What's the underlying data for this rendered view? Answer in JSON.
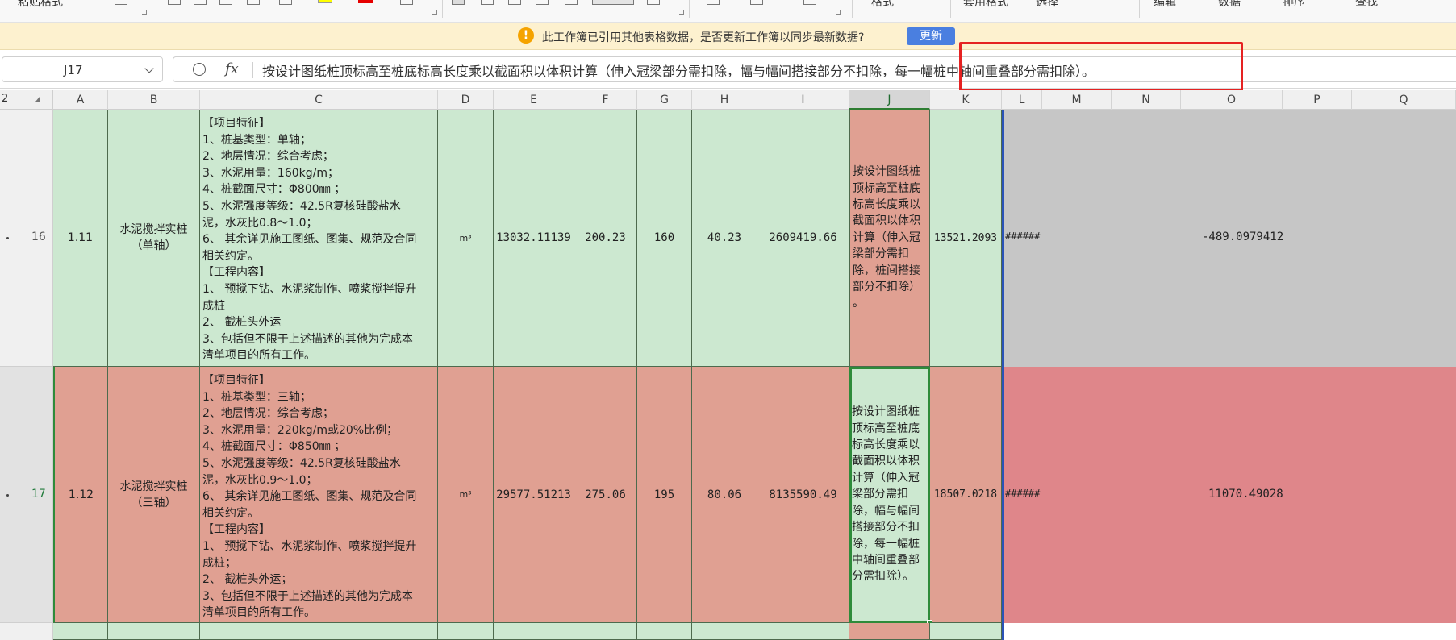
{
  "ribbon": {
    "items": [
      "粘贴格式",
      "格式",
      "编辑",
      "数据",
      "套用格式",
      "选择",
      "排序",
      "查找"
    ],
    "accent_colors": [
      "#ffff00",
      "#e60000"
    ]
  },
  "notification": {
    "icon": "warning-icon",
    "message": "此工作簿已引用其他表格数据，是否更新工作簿以同步最新数据?",
    "button": "更新"
  },
  "formula_bar": {
    "name_box": "J17",
    "fx": "fx",
    "content": "按设计图纸桩顶标高至桩底标高长度乘以截面积以体积计算（伸入冠梁部分需扣除，幅与幅间搭接部分不扣除，每一幅桩中轴间重叠部分需扣除）。"
  },
  "sheet": {
    "corner_label": "2",
    "columns": [
      "A",
      "B",
      "C",
      "D",
      "E",
      "F",
      "G",
      "H",
      "I",
      "J",
      "K",
      "L",
      "M",
      "N",
      "O",
      "P",
      "Q"
    ],
    "selected_column": "J",
    "rows": [
      {
        "row_number": "16",
        "A": "1.11",
        "B": "水泥搅拌实桩\n（单轴）",
        "C": "【项目特征】\n1、桩基类型：单轴；\n2、地层情况：综合考虑；\n3、水泥用量：160kg/m；\n4、桩截面尺寸：Φ800㎜ ；\n5、水泥强度等级：42.5R复核硅酸盐水\n泥，水灰比0.8～1.0；\n6、 其余详见施工图纸、图集、规范及合同\n相关约定。\n【工程内容】\n1、 预搅下钻、水泥浆制作、喷浆搅拌提升\n成桩\n2、 截桩头外运\n3、包括但不限于上述描述的其他为完成本\n清单项目的所有工作。",
        "D": "m³",
        "E": "13032.11139",
        "F": "200.23",
        "G": "160",
        "H": "40.23",
        "I": "2609419.66",
        "J": "按设计图纸桩\n顶标高至桩底\n标高长度乘以\n截面积以体积\n计算（伸入冠\n梁部分需扣\n除，桩间搭接\n部分不扣除）\n。",
        "K": "13521.2093",
        "L": "######",
        "O": "-489.0979412"
      },
      {
        "row_number": "17",
        "A": "1.12",
        "B": "水泥搅拌实桩\n（三轴）",
        "C": "【项目特征】\n1、桩基类型：三轴；\n2、地层情况：综合考虑；\n3、水泥用量：220kg/m或20%比例；\n4、桩截面尺寸：Φ850㎜ ；\n5、水泥强度等级：42.5R复核硅酸盐水\n泥，水灰比0.9～1.0；\n6、 其余详见施工图纸、图集、规范及合同\n相关约定。\n【工程内容】\n1、 预搅下钻、水泥浆制作、喷浆搅拌提升\n成桩；\n2、 截桩头外运；\n3、包括但不限于上述描述的其他为完成本\n清单项目的所有工作。",
        "D": "m³",
        "E": "29577.51213",
        "F": "275.06",
        "G": "195",
        "H": "80.06",
        "I": "8135590.49",
        "J": "按设计图纸桩\n顶标高至桩底\n标高长度乘以\n截面积以体积\n计算（伸入冠\n梁部分需扣\n除，幅与幅间\n搭接部分不扣\n除，每一幅桩\n中轴间重叠部\n分需扣除）。",
        "K": "18507.0218",
        "L": "######",
        "O": "11070.49028"
      }
    ]
  }
}
